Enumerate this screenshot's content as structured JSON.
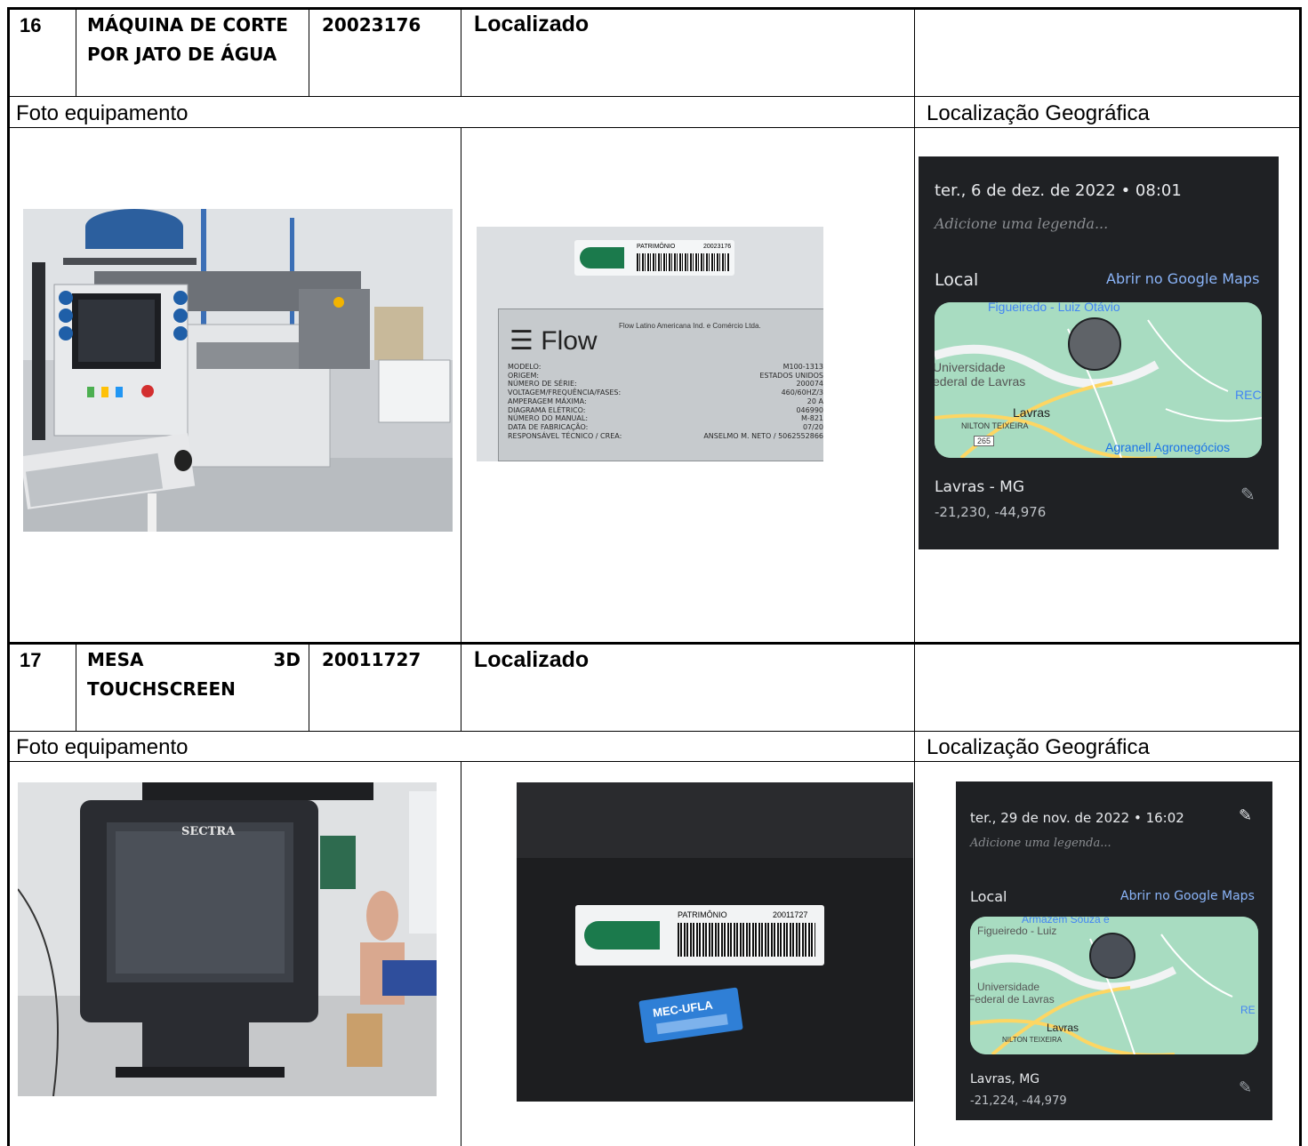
{
  "rows": [
    {
      "number": "16",
      "name_line1": "MÁQUINA DE CORTE",
      "name_line2": "POR JATO DE ÁGUA",
      "asset_code": "20023176",
      "status": "Localizado",
      "photo_header": "Foto equipamento",
      "geo_header": "Localização Geográfica",
      "tag_label": "PATRIMÔNIO",
      "tag_number": "20023176",
      "plate": {
        "brand": "Flow",
        "company": "Flow Latino Americana Ind. e Comércio Ltda.",
        "fields": [
          {
            "label": "MODELO:",
            "value": "M100-1313"
          },
          {
            "label": "ORIGEM:",
            "value": "ESTADOS UNIDOS"
          },
          {
            "label": "NÚMERO DE SÉRIE:",
            "value": "200074"
          },
          {
            "label": "VOLTAGEM/FREQUÊNCIA/FASES:",
            "value": "460/60HZ/3"
          },
          {
            "label": "AMPERAGEM MÁXIMA:",
            "value": "20 A"
          },
          {
            "label": "DIAGRAMA ELÉTRICO:",
            "value": "046990"
          },
          {
            "label": "NÚMERO DO MANUAL:",
            "value": "M-821"
          },
          {
            "label": "DATA DE FABRICAÇÃO:",
            "value": "07/20"
          },
          {
            "label": "RESPONSÁVEL TÉCNICO / CREA:",
            "value": "ANSELMO M. NETO / 5062552866"
          }
        ]
      },
      "geo": {
        "datetime": "ter., 6 de dez. de 2022 • 08:01",
        "caption": "Adicione uma legenda...",
        "local_label": "Local",
        "maps_link": "Abrir no Google Maps",
        "map_labels": {
          "top": "Figueiredo - Luiz Otávio",
          "univ1": "Universidade",
          "univ2": "ederal de Lavras",
          "city": "Lavras",
          "street": "NILTON TEIXEIRA",
          "road": "265",
          "right": "REC",
          "biz": "Agranell Agronegócios"
        },
        "place": "Lavras - MG",
        "coords": "-21,230, -44,976"
      }
    },
    {
      "number": "17",
      "name_line1a": "MESA",
      "name_line1b": "3D",
      "name_line2": "TOUCHSCREEN",
      "asset_code": "20011727",
      "status": "Localizado",
      "photo_header": "Foto equipamento",
      "geo_header": "Localização Geográfica",
      "tag_label": "PATRIMÔNIO",
      "tag_number": "20011727",
      "blue_tag": "MEC-UFLA",
      "screen_brand": "SECTRA",
      "geo": {
        "datetime": "ter., 29 de nov. de 2022 • 16:02",
        "caption": "Adicione uma legenda...",
        "local_label": "Local",
        "maps_link": "Abrir no Google Maps",
        "map_labels": {
          "top1": "Armazém Souza e",
          "top2": "Figueiredo - Luiz",
          "univ1": "Universidade",
          "univ2": "Federal de Lavras",
          "city": "Lavras",
          "street": "NILTON TEIXEIRA",
          "right": "RE"
        },
        "place": "Lavras, MG",
        "coords": "-21,224, -44,979"
      }
    }
  ],
  "colors": {
    "geo_bg": "#1f2124",
    "map_green": "#a8dcc1",
    "link_blue": "#8ab4f8"
  }
}
